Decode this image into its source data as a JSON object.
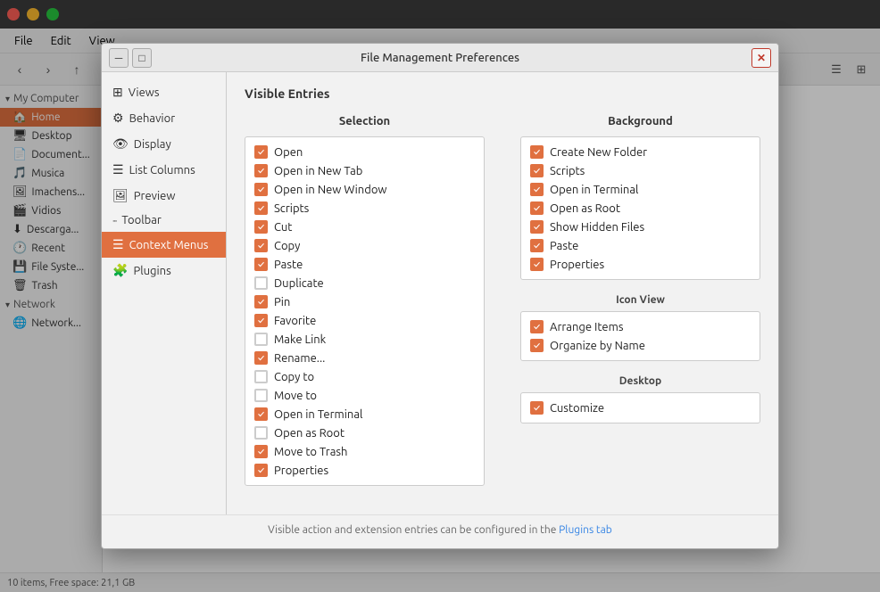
{
  "app": {
    "title": "File Management Preferences",
    "window_controls": {
      "close": "✕",
      "minimize": "─",
      "maximize": "□"
    }
  },
  "file_manager": {
    "menu_items": [
      "File",
      "Edit",
      "View"
    ],
    "statusbar": "10 items, Free space: 21,1 GB",
    "sidebar": {
      "my_computer_label": "My Computer",
      "network_label": "Network",
      "items": [
        {
          "label": "Home",
          "icon": "🏠",
          "active": true
        },
        {
          "label": "Desktop",
          "icon": "🖥"
        },
        {
          "label": "Document...",
          "icon": "📄"
        },
        {
          "label": "Musica",
          "icon": "🎵"
        },
        {
          "label": "Imachens...",
          "icon": "🖼"
        },
        {
          "label": "Vidios",
          "icon": "🎬"
        },
        {
          "label": "Descarga...",
          "icon": "⬇"
        },
        {
          "label": "Recent",
          "icon": "🕐"
        },
        {
          "label": "File Syste...",
          "icon": "💾"
        },
        {
          "label": "Trash",
          "icon": "🗑"
        },
        {
          "label": "Network...",
          "icon": "🌐"
        }
      ]
    }
  },
  "dialog": {
    "title": "File Management Preferences",
    "nav_items": [
      {
        "label": "Views",
        "icon": "⊞",
        "active": false
      },
      {
        "label": "Behavior",
        "icon": "⚙",
        "active": false
      },
      {
        "label": "Display",
        "icon": "👁",
        "active": false
      },
      {
        "label": "List Columns",
        "icon": "☰",
        "active": false
      },
      {
        "label": "Preview",
        "icon": "🖼",
        "active": false
      },
      {
        "label": "Toolbar",
        "icon": "···",
        "active": false
      },
      {
        "label": "Context Menus",
        "icon": "☰",
        "active": true
      },
      {
        "label": "Plugins",
        "icon": "🧩",
        "active": false
      }
    ],
    "content": {
      "header": "Visible Entries",
      "selection_label": "Selection",
      "background_label": "Background",
      "icon_view_label": "Icon View",
      "desktop_label": "Desktop",
      "selection_items": [
        {
          "label": "Open",
          "checked": true
        },
        {
          "label": "Open in New Tab",
          "checked": true
        },
        {
          "label": "Open in New Window",
          "checked": true
        },
        {
          "label": "Scripts",
          "checked": true
        },
        {
          "label": "Cut",
          "checked": true
        },
        {
          "label": "Copy",
          "checked": true
        },
        {
          "label": "Paste",
          "checked": true
        },
        {
          "label": "Duplicate",
          "checked": false
        },
        {
          "label": "Pin",
          "checked": true
        },
        {
          "label": "Favorite",
          "checked": true
        },
        {
          "label": "Make Link",
          "checked": false
        },
        {
          "label": "Rename...",
          "checked": true
        },
        {
          "label": "Copy to",
          "checked": false
        },
        {
          "label": "Move to",
          "checked": false
        },
        {
          "label": "Open in Terminal",
          "checked": true
        },
        {
          "label": "Open as Root",
          "checked": false
        },
        {
          "label": "Move to Trash",
          "checked": true
        },
        {
          "label": "Properties",
          "checked": true
        }
      ],
      "background_items": [
        {
          "label": "Create New Folder",
          "checked": true
        },
        {
          "label": "Scripts",
          "checked": true
        },
        {
          "label": "Open in Terminal",
          "checked": true
        },
        {
          "label": "Open as Root",
          "checked": true
        },
        {
          "label": "Show Hidden Files",
          "checked": true
        },
        {
          "label": "Paste",
          "checked": true
        },
        {
          "label": "Properties",
          "checked": true
        }
      ],
      "icon_view_items": [
        {
          "label": "Arrange Items",
          "checked": true
        },
        {
          "label": "Organize by Name",
          "checked": true
        }
      ],
      "desktop_items": [
        {
          "label": "Customize",
          "checked": true
        }
      ],
      "footer_text": "Visible action and extension entries can be configured in the ",
      "footer_link": "Plugins tab"
    }
  }
}
